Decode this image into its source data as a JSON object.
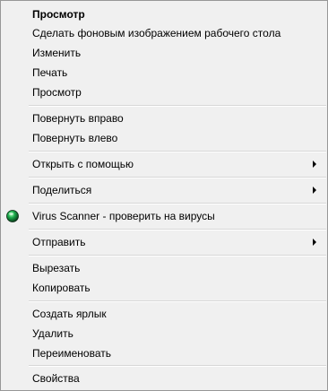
{
  "menu": {
    "items": [
      {
        "label": "Просмотр"
      },
      {
        "label": "Сделать фоновым изображением рабочего стола"
      },
      {
        "label": "Изменить"
      },
      {
        "label": "Печать"
      },
      {
        "label": "Просмотр"
      },
      {
        "label": "Повернуть вправо"
      },
      {
        "label": "Повернуть влево"
      },
      {
        "label": "Открыть с помощью"
      },
      {
        "label": "Поделиться"
      },
      {
        "label": "Virus Scanner - проверить на вирусы",
        "icon": "virus-scanner-icon"
      },
      {
        "label": "Отправить"
      },
      {
        "label": "Вырезать"
      },
      {
        "label": "Копировать"
      },
      {
        "label": "Создать ярлык"
      },
      {
        "label": "Удалить"
      },
      {
        "label": "Переименовать"
      },
      {
        "label": "Свойства"
      }
    ]
  }
}
